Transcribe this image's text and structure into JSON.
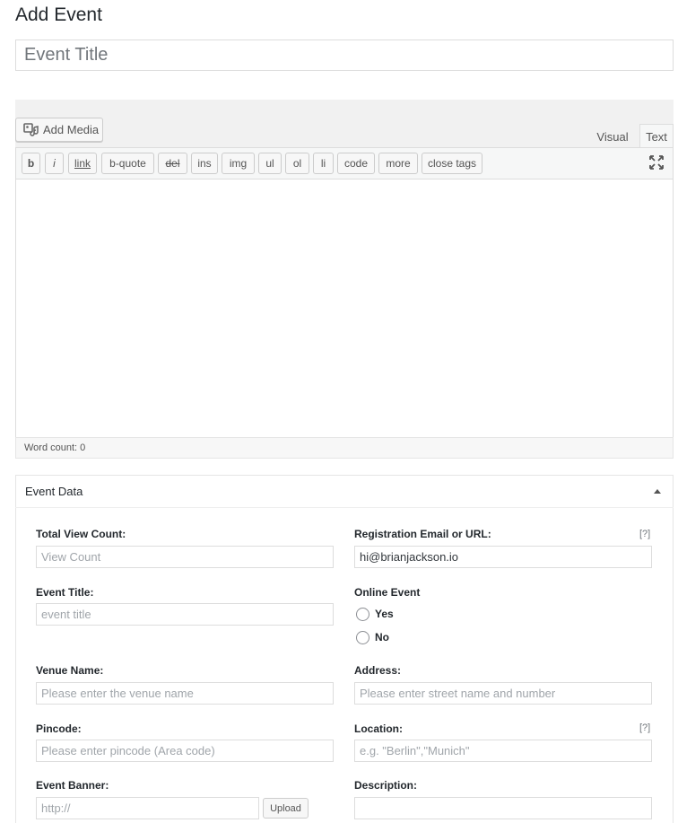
{
  "page": {
    "title": "Add Event"
  },
  "title_field": {
    "placeholder": "Event Title"
  },
  "editor": {
    "add_media_label": "Add Media",
    "tabs": {
      "visual": "Visual",
      "text": "Text"
    },
    "quicktags": [
      "b",
      "i",
      "link",
      "b-quote",
      "del",
      "ins",
      "img",
      "ul",
      "ol",
      "li",
      "code",
      "more",
      "close tags"
    ],
    "word_count": "Word count: 0"
  },
  "event_data": {
    "title": "Event Data",
    "total_view_count": {
      "label": "Total View Count:",
      "placeholder": "View Count"
    },
    "registration": {
      "label": "Registration Email or URL:",
      "help": "[?]",
      "value": "hi@brianjackson.io"
    },
    "event_title": {
      "label": "Event Title:",
      "placeholder": "event title"
    },
    "online_event": {
      "label": "Online Event",
      "options": [
        "Yes",
        "No"
      ]
    },
    "venue_name": {
      "label": "Venue Name:",
      "placeholder": "Please enter the venue name"
    },
    "address": {
      "label": "Address:",
      "placeholder": "Please enter street name and number"
    },
    "pincode": {
      "label": "Pincode:",
      "placeholder": "Please enter pincode (Area code)"
    },
    "location": {
      "label": "Location:",
      "help": "[?]",
      "placeholder": "e.g. \"Berlin\",\"Munich\""
    },
    "event_banner": {
      "label": "Event Banner:",
      "placeholder": "http://",
      "upload_label": "Upload"
    },
    "description": {
      "label": "Description:"
    }
  }
}
